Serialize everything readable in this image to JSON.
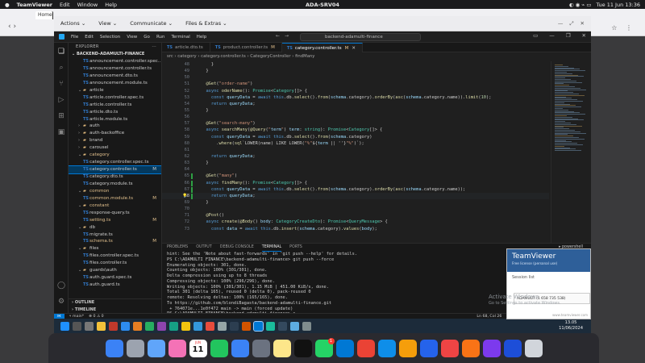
{
  "mac": {
    "app_name": "TeamViewer",
    "menus": [
      "Edit",
      "Window",
      "Help"
    ],
    "window_title": "ADA-SRV04",
    "clock": "Tue 11 Jun 13:36"
  },
  "browser": {
    "tab_label": "Home"
  },
  "teamviewer": {
    "toolbar": [
      "Actions",
      "View",
      "Communicate",
      "Files & Extras"
    ]
  },
  "vscode": {
    "menus": [
      "File",
      "Edit",
      "Selection",
      "View",
      "Go",
      "Run",
      "Terminal",
      "Help"
    ],
    "search": "backend-adamulti-finance",
    "explorer": {
      "header": "EXPLORER",
      "project": "BACKEND-ADAMULTI-FINANCE",
      "rows": [
        {
          "label": "announcement.controller.spec...",
          "type": "ts",
          "indent": 3,
          "status": ""
        },
        {
          "label": "announcement.controller.ts",
          "type": "ts",
          "indent": 3,
          "status": ""
        },
        {
          "label": "announcement.dto.ts",
          "type": "ts",
          "indent": 3,
          "status": ""
        },
        {
          "label": "announcement.module.ts",
          "type": "ts",
          "indent": 3,
          "status": ""
        },
        {
          "label": "article",
          "type": "folder-open",
          "indent": 2,
          "status": ""
        },
        {
          "label": "article.controller.spec.ts",
          "type": "ts",
          "indent": 3,
          "status": ""
        },
        {
          "label": "article.controller.ts",
          "type": "ts",
          "indent": 3,
          "status": ""
        },
        {
          "label": "article.dto.ts",
          "type": "ts",
          "indent": 3,
          "status": ""
        },
        {
          "label": "article.module.ts",
          "type": "ts",
          "indent": 3,
          "status": ""
        },
        {
          "label": "auth",
          "type": "folder",
          "indent": 2,
          "status": ""
        },
        {
          "label": "auth-backoffice",
          "type": "folder",
          "indent": 2,
          "status": ""
        },
        {
          "label": "brand",
          "type": "folder",
          "indent": 2,
          "status": ""
        },
        {
          "label": "carousel",
          "type": "folder",
          "indent": 2,
          "status": ""
        },
        {
          "label": "category",
          "type": "folder-open",
          "indent": 2,
          "status": "",
          "mod": true
        },
        {
          "label": "category.controller.spec.ts",
          "type": "ts",
          "indent": 3,
          "status": ""
        },
        {
          "label": "category.controller.ts",
          "type": "ts",
          "indent": 3,
          "status": "M",
          "selected": true
        },
        {
          "label": "category.dto.ts",
          "type": "ts",
          "indent": 3,
          "status": ""
        },
        {
          "label": "category.module.ts",
          "type": "ts",
          "indent": 3,
          "status": ""
        },
        {
          "label": "common",
          "type": "folder-open",
          "indent": 2,
          "status": "",
          "mod": true
        },
        {
          "label": "common.module.ts",
          "type": "ts",
          "indent": 3,
          "status": "M",
          "mod": true
        },
        {
          "label": "constant",
          "type": "folder-open",
          "indent": 2,
          "status": "",
          "mod": true
        },
        {
          "label": "response-query.ts",
          "type": "ts",
          "indent": 3,
          "status": ""
        },
        {
          "label": "setting.ts",
          "type": "ts",
          "indent": 3,
          "status": "M",
          "mod": true
        },
        {
          "label": "db",
          "type": "folder-open",
          "indent": 2,
          "status": ""
        },
        {
          "label": "migrate.ts",
          "type": "ts",
          "indent": 3,
          "status": ""
        },
        {
          "label": "schema.ts",
          "type": "ts",
          "indent": 3,
          "status": "M",
          "mod": true
        },
        {
          "label": "files",
          "type": "folder-open",
          "indent": 2,
          "status": ""
        },
        {
          "label": "files.controller.spec.ts",
          "type": "ts",
          "indent": 3,
          "status": ""
        },
        {
          "label": "files.controller.ts",
          "type": "ts",
          "indent": 3,
          "status": ""
        },
        {
          "label": "guards\\auth",
          "type": "folder-open",
          "indent": 2,
          "status": ""
        },
        {
          "label": "auth.guard.spec.ts",
          "type": "ts",
          "indent": 3,
          "status": ""
        },
        {
          "label": "auth.guard.ts",
          "type": "ts",
          "indent": 3,
          "status": ""
        }
      ],
      "outline": "OUTLINE",
      "timeline": "TIMELINE"
    },
    "tabs": [
      {
        "label": "article.dto.ts",
        "modified": "",
        "active": false
      },
      {
        "label": "product.controller.ts",
        "modified": "M",
        "active": false
      },
      {
        "label": "category.controller.ts",
        "modified": "M",
        "active": true
      }
    ],
    "breadcrumbs": [
      "src",
      "category",
      "category.controller.ts",
      "CategoryController",
      "findMany"
    ],
    "code": [
      {
        "n": "48",
        "t": "    }"
      },
      {
        "n": "49",
        "t": "  }"
      },
      {
        "n": "50",
        "t": ""
      },
      {
        "n": "51",
        "t": "  @Get(\"order-name\")"
      },
      {
        "n": "52",
        "t": "  async oderName(): Promise<Category[]> {"
      },
      {
        "n": "53",
        "t": "    const queryData = await this.db.select().from(schema.category).orderBy(asc(schema.category.name)).limit(10);"
      },
      {
        "n": "54",
        "t": "    return queryData;"
      },
      {
        "n": "55",
        "t": "  }"
      },
      {
        "n": "56",
        "t": ""
      },
      {
        "n": "57",
        "t": "  @Get(\"search-many\")"
      },
      {
        "n": "58",
        "t": "  async searchMany(@Query(\"term\") term: string): Promise<Category[]> {"
      },
      {
        "n": "59",
        "t": "    const queryData = await this.db.select().from(schema.category)"
      },
      {
        "n": "60",
        "t": "      .where(sql`LOWER(name) LIKE LOWER(\"%\"${term || ''}\"%\")`);"
      },
      {
        "n": "61",
        "t": ""
      },
      {
        "n": "62",
        "t": "    return queryData;"
      },
      {
        "n": "63",
        "t": "  }"
      },
      {
        "n": "64",
        "t": ""
      },
      {
        "n": "65",
        "t": "  @Get(\"many\")"
      },
      {
        "n": "66",
        "t": "  async findMany(): Promise<Category[]> {"
      },
      {
        "n": "67",
        "t": "    const queryData = await this.db.select().from(schema.category).orderBy(asc(schema.category.name));"
      },
      {
        "n": "68",
        "t": "    return queryData;",
        "current": true
      },
      {
        "n": "69",
        "t": "  }"
      },
      {
        "n": "70",
        "t": ""
      },
      {
        "n": "71",
        "t": "  @Post()"
      },
      {
        "n": "72",
        "t": "  async create(@Body() body: CategoryCreateDto): Promise<QueryMessage> {"
      },
      {
        "n": "73",
        "t": "    const data = await this.db.insert(schema.category).values(body);"
      }
    ],
    "panel_tabs": [
      "PROBLEMS",
      "OUTPUT",
      "DEBUG CONSOLE",
      "TERMINAL",
      "PORTS"
    ],
    "shell": "powershell",
    "terminal": [
      "hint: See the 'Note about fast-forwards' in 'git push --help' for details.",
      "PS C:\\ADAMULTI FINANCE\\backend-adamulti-finance> git push --force",
      "Enumerating objects: 301, done.",
      "Counting objects: 100% (301/301), done.",
      "Delta compression using up to 8 threads",
      "Compressing objects: 100% (296/296), done.",
      "Writing objects: 100% (301/301), 1.15 MiB | 451.00 KiB/s, done.",
      "Total 301 (delta 165), reused 0 (delta 0), pack-reused 0",
      "remote: Resolving deltas: 100% (165/165), done.",
      "To https://github.com/blondiBagasta/backend-adamulti-finance.git",
      " + 764071e...1e0f472 main -> main (forced update)",
      "PS C:\\ADAMULTI FINANCE\\backend-adamulti-finance> "
    ],
    "status": {
      "branch": "main*",
      "errors": "0",
      "warnings": "0",
      "position": "Ln 68, Col 26",
      "spaces": "Spaces: 2",
      "encoding": "UTF-8",
      "eol": "CRLF",
      "lang": "TypeScript"
    }
  },
  "taskbar": {
    "time": "13.05",
    "date": "11/06/2024"
  },
  "tv_panel": {
    "name": "TeamViewer",
    "subtitle": "Free license (personal use)",
    "session": "Session list",
    "session_id": "ADAMULTI (1 658 735 538)",
    "web": "www.teamviewer.com",
    "watermark": "Activate Windows",
    "watermark_sub": "Go to Settings to activate Windows."
  },
  "dock": {
    "calendar_month": "JUN",
    "calendar_day": "11",
    "whatsapp_badge": "1"
  }
}
